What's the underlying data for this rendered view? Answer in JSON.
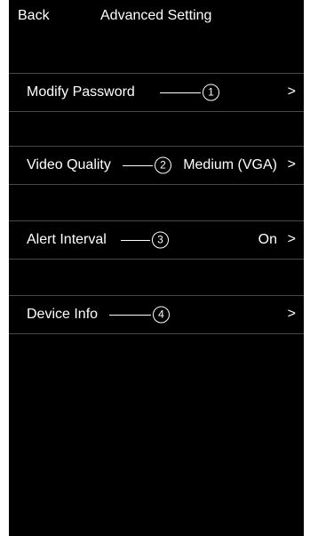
{
  "nav": {
    "back_label": "Back",
    "title": "Advanced Setting"
  },
  "settings": {
    "items": [
      {
        "label": "Modify Password",
        "callout": "1",
        "value": "",
        "chevron": ">"
      },
      {
        "label": "Video Quality",
        "callout": "2",
        "value": "Medium (VGA)",
        "chevron": ">"
      },
      {
        "label": "Alert Interval",
        "callout": "3",
        "value": "On",
        "chevron": ">"
      },
      {
        "label": "Device Info",
        "callout": "4",
        "value": "",
        "chevron": ">"
      }
    ]
  },
  "colors": {
    "background": "#000000",
    "text": "#ffffff",
    "separator": "#4a4a4a"
  }
}
